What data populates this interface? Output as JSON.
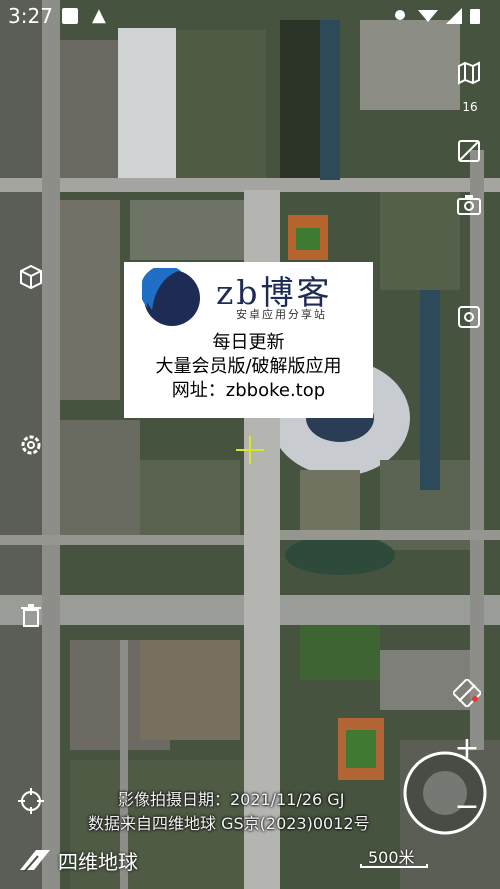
{
  "status_bar": {
    "time": "3:27"
  },
  "map": {
    "zoom_level": "16"
  },
  "watermark": {
    "brand": "zb博客",
    "tagline": "安卓应用分享站",
    "line1": "每日更新",
    "line2": "大量会员版/破解版应用",
    "line3": "网址：zbboke.top"
  },
  "captions": {
    "capture_date": "影像拍摄日期：2021/11/26 GJ",
    "data_source": "数据来自四维地球 GS京(2023)0012号"
  },
  "brand_logo": "四维地球",
  "scale_label": "500米",
  "colors": {
    "crosshair": "#d8e62a",
    "card_brand": "#1d2b55",
    "logo_blue": "#1f6fc6"
  }
}
